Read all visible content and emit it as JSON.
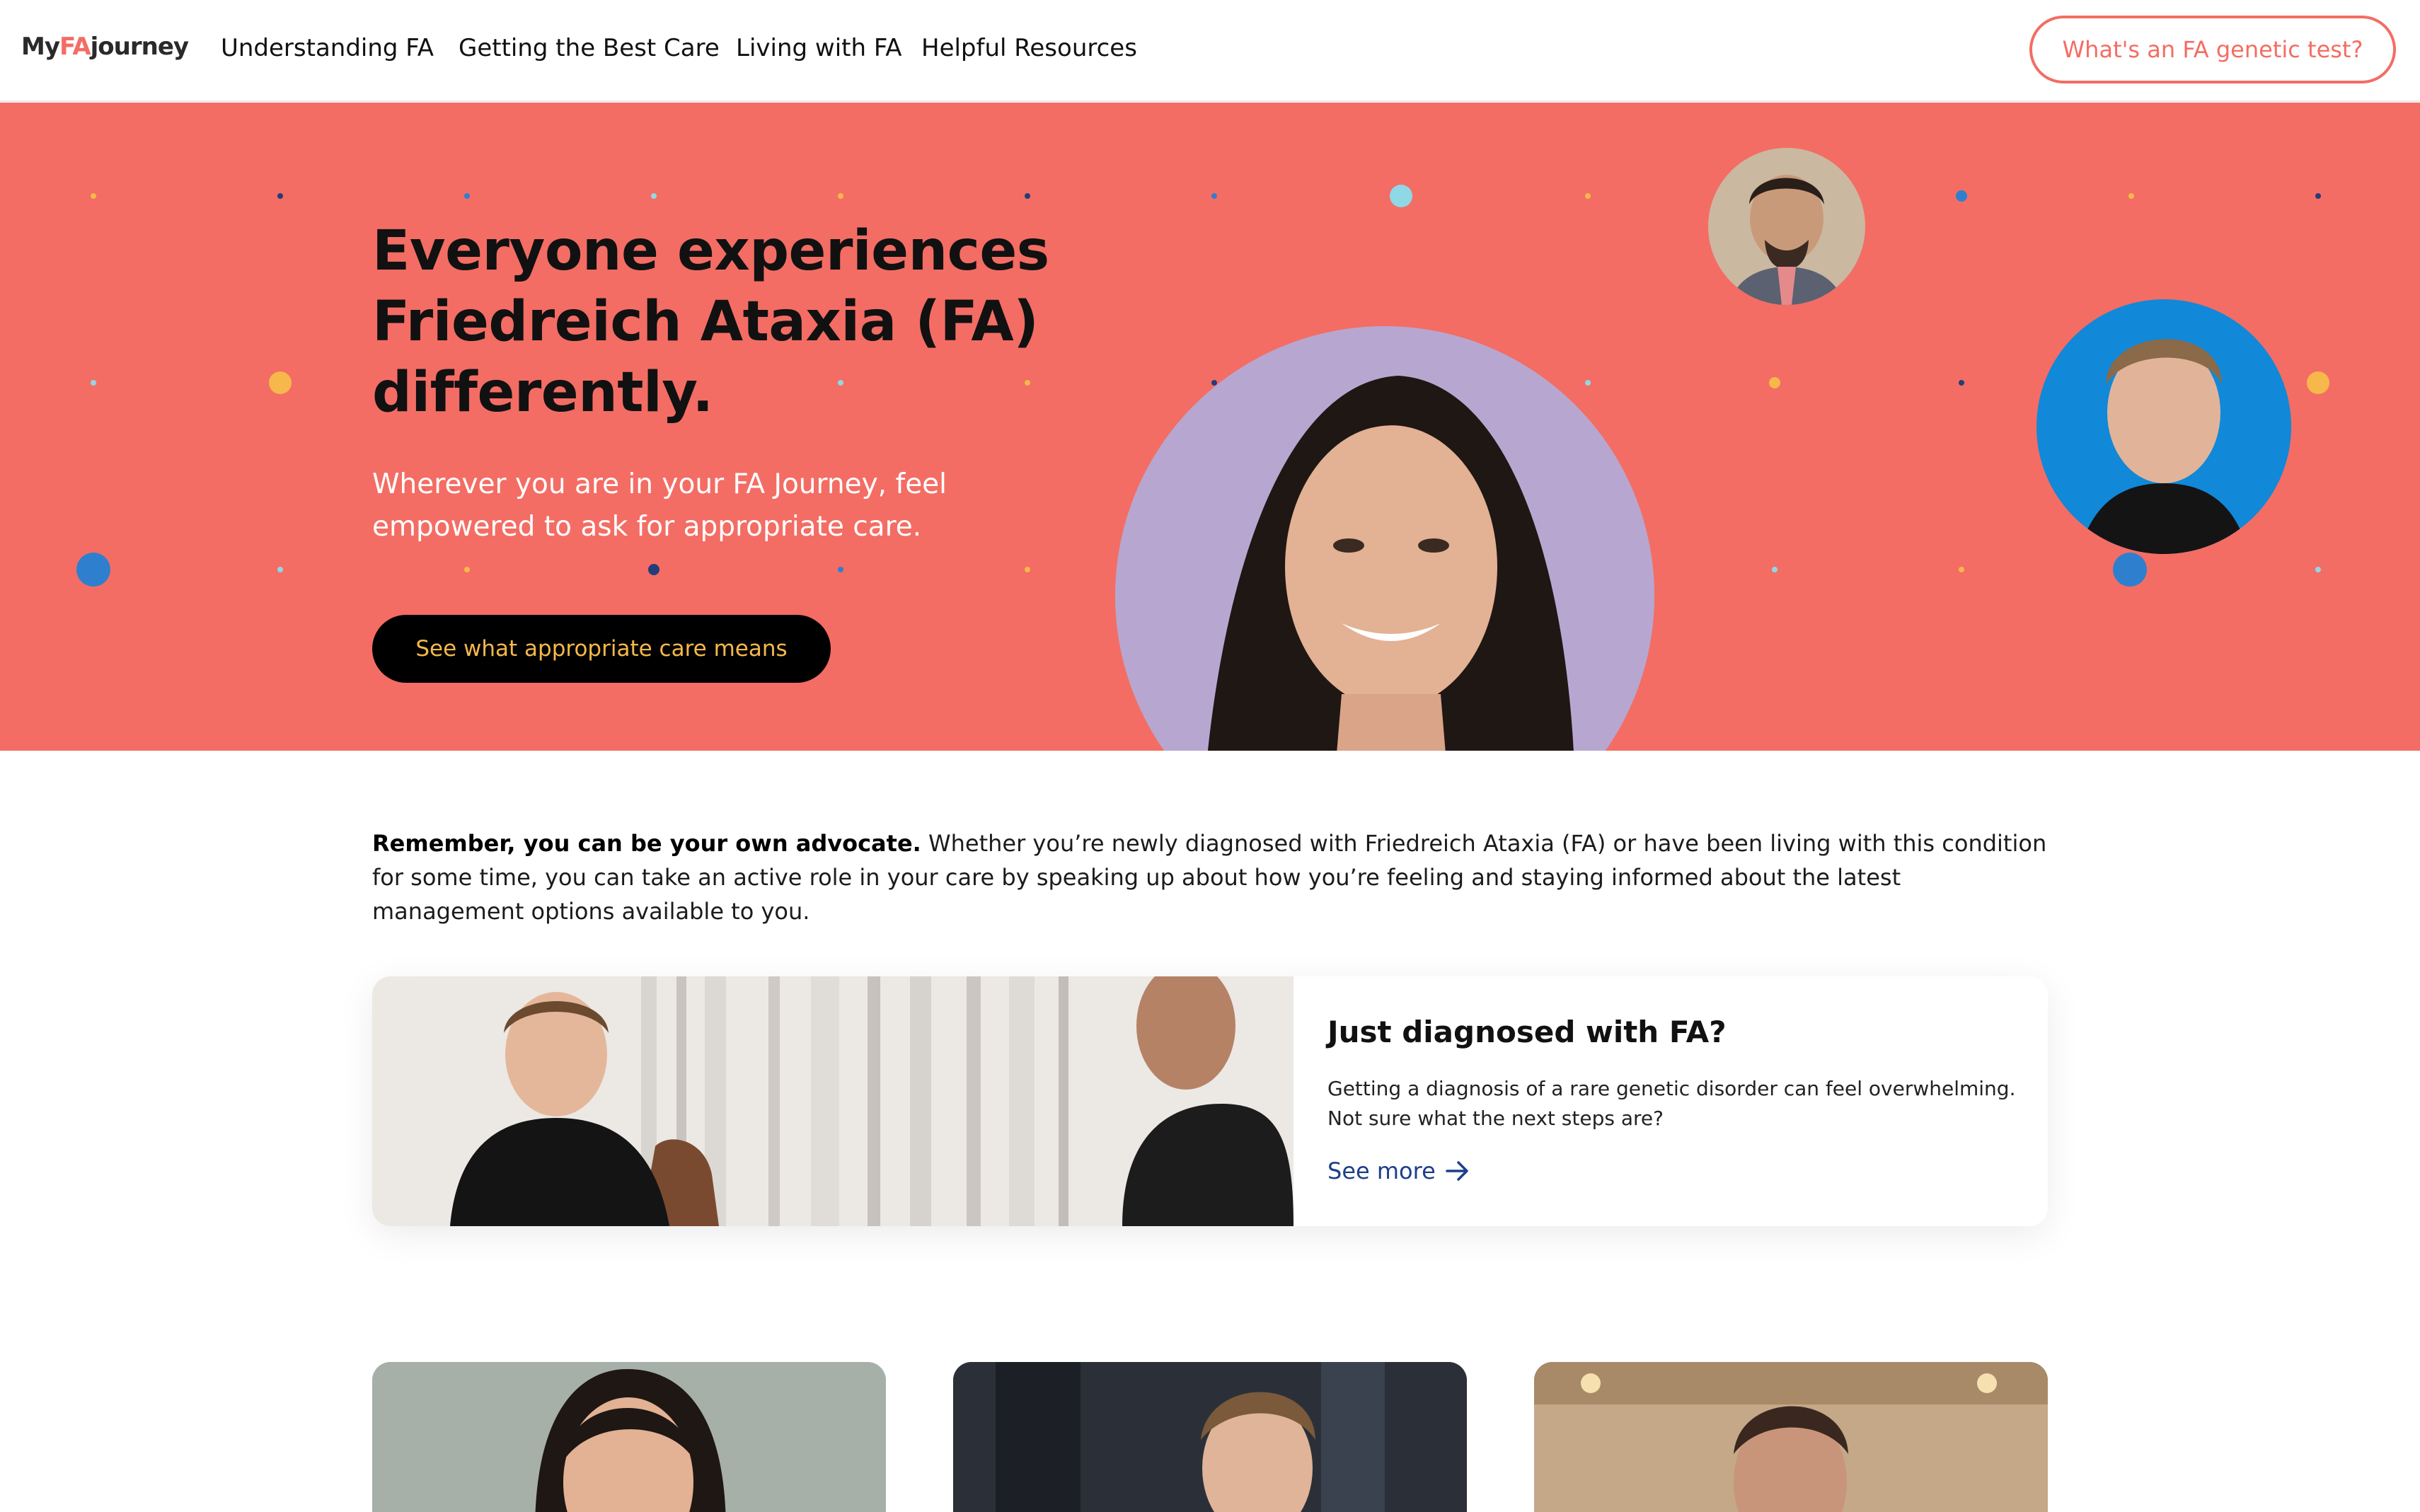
{
  "header": {
    "logo": {
      "prefix": "My",
      "accent": "FA",
      "suffix": "journey"
    },
    "nav": [
      {
        "label": "Understanding FA"
      },
      {
        "label": "Getting the Best Care"
      },
      {
        "label": "Living with FA"
      },
      {
        "label": "Helpful Resources"
      }
    ],
    "cta_label": "What's an FA genetic test?"
  },
  "hero": {
    "title": "Everyone experiences Friedreich Ataxia (FA) differently.",
    "subtitle": "Wherever you are in your FA Journey, feel empowered to ask for appropriate care.",
    "button_label": "See what appropriate care means"
  },
  "intro": {
    "lead": "Remember, you can be your own advocate.",
    "body": " Whether you’re newly diagnosed with Friedreich Ataxia (FA) or have been living with this condition for some time, you can take an active role in your care by speaking up about how you’re feeling and staying informed about the latest management options available to you."
  },
  "feature": {
    "title": "Just diagnosed with FA?",
    "body": "Getting a diagnosis of a rare genetic disorder can feel overwhelming. Not sure what the next steps are?",
    "link_label": "See more",
    "link_icon": "arrow-right-icon"
  },
  "colors": {
    "brand_coral": "#f36d64",
    "hero_button_bg": "#000000",
    "hero_button_text": "#f6b84a",
    "link_blue": "#1d3f8a",
    "dot_blue": "#2f7fcf",
    "dot_yellow": "#f6b84a",
    "dot_navy": "#243c7a",
    "dot_teal": "#8fd8e6"
  }
}
